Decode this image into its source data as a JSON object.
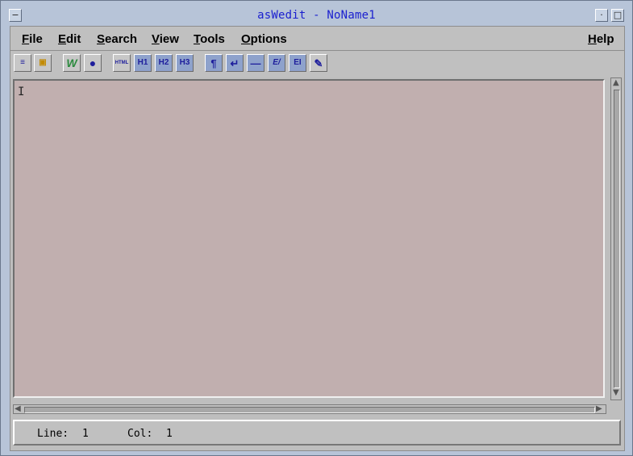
{
  "window": {
    "title": "asWedit - NoName1",
    "menu_button_glyph": "−",
    "minimize_glyph": "·",
    "maximize_glyph": "□"
  },
  "menu": {
    "file": {
      "first": "F",
      "rest": "ile"
    },
    "edit": {
      "first": "E",
      "rest": "dit"
    },
    "search": {
      "first": "S",
      "rest": "earch"
    },
    "view": {
      "first": "V",
      "rest": "iew"
    },
    "tools": {
      "first": "T",
      "rest": "ools"
    },
    "options": {
      "first": "O",
      "rest": "ptions"
    },
    "help": {
      "first": "H",
      "rest": "elp"
    }
  },
  "toolbar": {
    "buttons": [
      {
        "name": "new-file-icon",
        "glyph": "≡"
      },
      {
        "name": "save-icon",
        "glyph": "▣"
      },
      {
        "name": "wrap-w-icon",
        "glyph": "W"
      },
      {
        "name": "preview-globe-icon",
        "glyph": "●"
      },
      {
        "name": "html-doc-icon",
        "glyph": "HTML"
      },
      {
        "name": "heading1-icon",
        "glyph": "H1"
      },
      {
        "name": "heading2-icon",
        "glyph": "H2"
      },
      {
        "name": "heading3-icon",
        "glyph": "H3"
      },
      {
        "name": "paragraph-icon",
        "glyph": "¶"
      },
      {
        "name": "line-break-icon",
        "glyph": "↵"
      },
      {
        "name": "horizontal-rule-icon",
        "glyph": "—"
      },
      {
        "name": "emphasis-icon",
        "glyph": "E/"
      },
      {
        "name": "strong-icon",
        "glyph": "EI"
      },
      {
        "name": "link-pen-icon",
        "glyph": "✎"
      }
    ]
  },
  "editor": {
    "content": "",
    "cursor_glyph": "I"
  },
  "scroll": {
    "up": "▲",
    "down": "▼",
    "left": "◀",
    "right": "▶"
  },
  "status": {
    "line_label": "Line:",
    "line_value": "1",
    "col_label": "Col:",
    "col_value": "1"
  }
}
